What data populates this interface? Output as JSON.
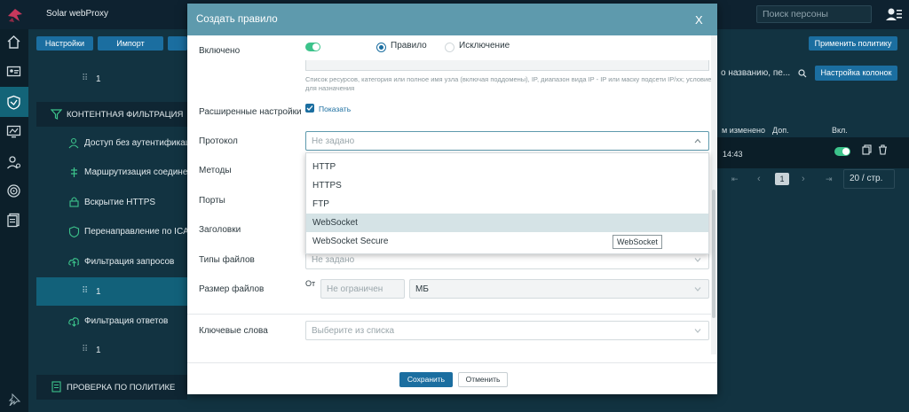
{
  "app": {
    "title": "Solar webProxy",
    "person_search_placeholder": "Поиск персоны"
  },
  "toolbar": {
    "settings_label": "Настройки",
    "import_label": "Импорт",
    "apply_policy_label": "Применить политику"
  },
  "tree": {
    "item_top_num": "1",
    "section_content": "КОНТЕНТНАЯ ФИЛЬТРАЦИЯ",
    "items": [
      "Доступ без аутентификации",
      "Маршрутизация соединений",
      "Вскрытие HTTPS",
      "Перенаправление по ICAP",
      "Фильтрация запросов"
    ],
    "sub_selected_num": "1",
    "responses_label": "Фильтрация ответов",
    "sub_responses_num": "1",
    "section_policy": "ПРОВЕРКА ПО ПОЛИТИКЕ"
  },
  "right": {
    "search_partial": "о названию, пе...",
    "columns_button": "Настройка колонок",
    "col_changed": "м изменено",
    "col_extra": "Доп.",
    "col_enabled": "Вкл.",
    "row_time": "14:43",
    "page_current": "1",
    "page_size": "20 / стр."
  },
  "modal": {
    "title": "Создать правило",
    "close": "X",
    "enabled_label": "Включено",
    "enabled_on": true,
    "radio_rule": "Правило",
    "radio_exception": "Исключение",
    "resource_hint": "Список ресурсов, категория или полное имя узла (включая поддомены), IP, диапазон вида IP - IP или маску подсети IP/xx; условие для назначения",
    "advanced_label": "Расширенные настройки",
    "advanced_show": "Показать",
    "protocol_label": "Протокол",
    "protocol_placeholder": "Не задано",
    "methods_label": "Методы",
    "ports_label": "Порты",
    "headers_label": "Заголовки",
    "filetypes_label": "Типы файлов",
    "filetypes_placeholder": "Не задано",
    "filesize_label": "Размер файлов",
    "filesize_from": "От",
    "filesize_placeholder": "Не ограничен",
    "filesize_unit": "МБ",
    "keywords_label": "Ключевые слова",
    "keywords_placeholder": "Выберите из списка",
    "protocol_options": [
      "HTTP",
      "HTTPS",
      "FTP",
      "WebSocket",
      "WebSocket Secure"
    ],
    "tooltip": "WebSocket",
    "save": "Сохранить",
    "cancel": "Отменить"
  },
  "colors": {
    "accent": "#1b6ea0",
    "header": "#5e9aad",
    "toggle_on": "#3cc38b"
  }
}
